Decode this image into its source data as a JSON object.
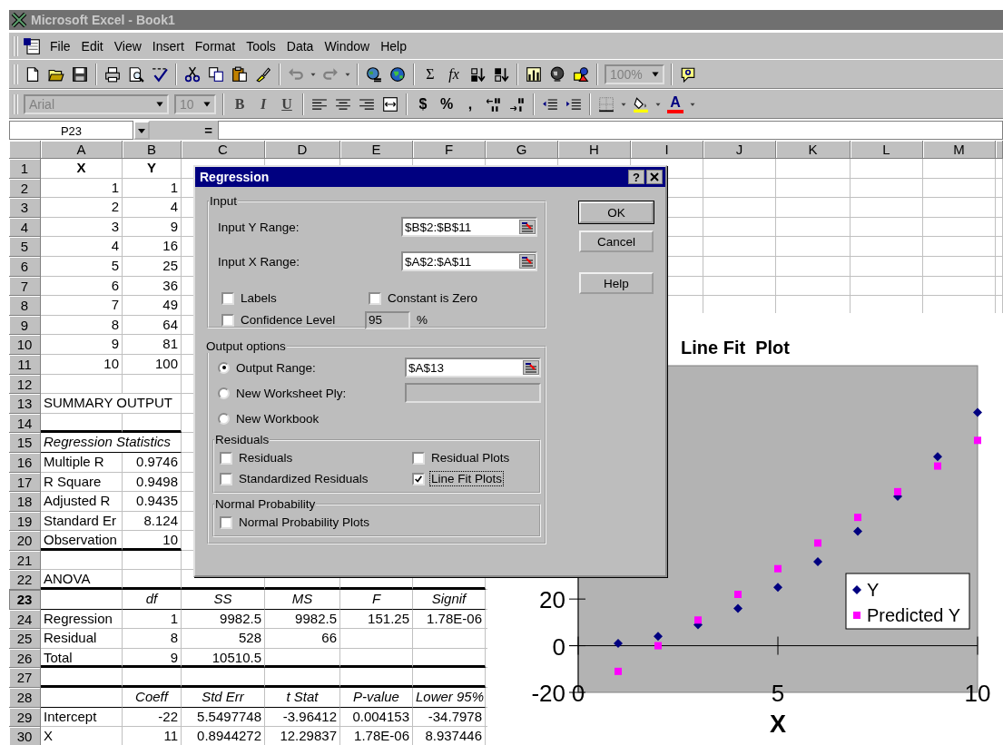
{
  "window": {
    "title": "Microsoft Excel - Book1",
    "active": false
  },
  "menu": [
    "File",
    "Edit",
    "View",
    "Insert",
    "Format",
    "Tools",
    "Data",
    "Window",
    "Help"
  ],
  "standard_toolbar": [
    {
      "kind": "new"
    },
    {
      "kind": "open"
    },
    {
      "kind": "save"
    },
    {
      "kind": "sep"
    },
    {
      "kind": "print"
    },
    {
      "kind": "preview"
    },
    {
      "kind": "spelling"
    },
    {
      "kind": "sep"
    },
    {
      "kind": "cut"
    },
    {
      "kind": "copy"
    },
    {
      "kind": "paste"
    },
    {
      "kind": "brush"
    },
    {
      "kind": "sep"
    },
    {
      "kind": "undo"
    },
    {
      "kind": "dropdown"
    },
    {
      "kind": "redo"
    },
    {
      "kind": "dropdown"
    },
    {
      "kind": "sep"
    },
    {
      "kind": "hyperlink"
    },
    {
      "kind": "web"
    },
    {
      "kind": "sep"
    },
    {
      "kind": "sum",
      "text": "Σ"
    },
    {
      "kind": "function",
      "text": "fx"
    },
    {
      "kind": "sort-asc"
    },
    {
      "kind": "sort-desc"
    },
    {
      "kind": "sep"
    },
    {
      "kind": "chart"
    },
    {
      "kind": "map"
    },
    {
      "kind": "drawing"
    },
    {
      "kind": "sep"
    },
    {
      "kind": "zoom",
      "text": "100%",
      "disabled": true
    },
    {
      "kind": "sep"
    },
    {
      "kind": "help"
    }
  ],
  "formatting_toolbar": [
    {
      "kind": "font",
      "text": "Arial",
      "disabled": true
    },
    {
      "kind": "size",
      "text": "10",
      "disabled": true
    },
    {
      "kind": "sep"
    },
    {
      "kind": "bold",
      "text": "B"
    },
    {
      "kind": "italic",
      "text": "I"
    },
    {
      "kind": "underline",
      "text": "U"
    },
    {
      "kind": "sep"
    },
    {
      "kind": "align-left"
    },
    {
      "kind": "align-center"
    },
    {
      "kind": "align-right"
    },
    {
      "kind": "merge"
    },
    {
      "kind": "sep"
    },
    {
      "kind": "currency",
      "text": "$"
    },
    {
      "kind": "percent",
      "text": "%"
    },
    {
      "kind": "comma",
      "text": ","
    },
    {
      "kind": "inc-decimal"
    },
    {
      "kind": "dec-decimal"
    },
    {
      "kind": "sep"
    },
    {
      "kind": "outdent"
    },
    {
      "kind": "indent"
    },
    {
      "kind": "sep"
    },
    {
      "kind": "borders"
    },
    {
      "kind": "dropdown"
    },
    {
      "kind": "fill-color",
      "color": "#ffff00"
    },
    {
      "kind": "dropdown"
    },
    {
      "kind": "font-color",
      "text": "A",
      "color": "#ff0000"
    },
    {
      "kind": "dropdown"
    }
  ],
  "formula_bar": {
    "name_box": "P23",
    "equals": "="
  },
  "columns": [
    "A",
    "B",
    "C",
    "D",
    "E",
    "F",
    "G",
    "H",
    "I",
    "J",
    "K",
    "L",
    "M"
  ],
  "rows": [
    {
      "number": "1",
      "selected": false,
      "kind": "header",
      "cells": {
        "a": "X",
        "b": "Y"
      },
      "rule_below": false
    },
    {
      "number": "2",
      "selected": false,
      "kind": "numbers",
      "cells": {
        "a": "1",
        "b": "1"
      },
      "rule_below": false
    },
    {
      "number": "3",
      "selected": false,
      "kind": "numbers",
      "cells": {
        "a": "2",
        "b": "4"
      },
      "rule_below": false
    },
    {
      "number": "4",
      "selected": false,
      "kind": "numbers",
      "cells": {
        "a": "3",
        "b": "9"
      },
      "rule_below": false
    },
    {
      "number": "5",
      "selected": false,
      "kind": "numbers",
      "cells": {
        "a": "4",
        "b": "16"
      },
      "rule_below": false
    },
    {
      "number": "6",
      "selected": false,
      "kind": "numbers",
      "cells": {
        "a": "5",
        "b": "25"
      },
      "rule_below": false
    },
    {
      "number": "7",
      "selected": false,
      "kind": "numbers",
      "cells": {
        "a": "6",
        "b": "36"
      },
      "rule_below": false
    },
    {
      "number": "8",
      "selected": false,
      "kind": "numbers",
      "cells": {
        "a": "7",
        "b": "49"
      },
      "rule_below": false
    },
    {
      "number": "9",
      "selected": false,
      "kind": "numbers",
      "cells": {
        "a": "8",
        "b": "64"
      },
      "rule_below": false
    },
    {
      "number": "10",
      "selected": false,
      "kind": "numbers",
      "cells": {
        "a": "9",
        "b": "81"
      },
      "rule_below": false
    },
    {
      "number": "11",
      "selected": false,
      "kind": "numbers",
      "cells": {
        "a": "10",
        "b": "100"
      },
      "rule_below": false
    },
    {
      "number": "12",
      "selected": false,
      "kind": "data",
      "rule_below": false
    },
    {
      "number": "13",
      "selected": false,
      "kind": "title",
      "cells": {
        "a": "SUMMARY OUTPUT"
      },
      "rule_below": false
    },
    {
      "number": "14",
      "selected": false,
      "kind": "data",
      "rule_below": true,
      "rule_heavy": true
    },
    {
      "number": "15",
      "selected": false,
      "kind": "italic-title",
      "cells": {
        "a": "Regression Statistics"
      },
      "rule_below": true,
      "rule_heavy": false
    },
    {
      "number": "16",
      "selected": false,
      "kind": "data",
      "cells": {
        "a": "Multiple R",
        "b": "0.9746"
      },
      "rule_below": false
    },
    {
      "number": "17",
      "selected": false,
      "kind": "data",
      "cells": {
        "a": "R Square",
        "b": "0.9498"
      },
      "rule_below": false
    },
    {
      "number": "18",
      "selected": false,
      "kind": "data",
      "cells": {
        "a": "Adjusted R",
        "b": "0.9435"
      },
      "rule_below": false
    },
    {
      "number": "19",
      "selected": false,
      "kind": "data",
      "cells": {
        "a": "Standard Er",
        "b": "8.124"
      },
      "rule_below": false
    },
    {
      "number": "20",
      "selected": false,
      "kind": "data",
      "cells": {
        "a": "Observation",
        "b": "10"
      },
      "rule_below": true,
      "rule_heavy": true
    },
    {
      "number": "21",
      "selected": false,
      "kind": "data",
      "rule_below": false
    },
    {
      "number": "22",
      "selected": false,
      "kind": "data",
      "cells": {
        "a": "ANOVA"
      },
      "rule_below": true,
      "rule_heavy": true
    },
    {
      "number": "23",
      "selected": true,
      "kind": "italic-heading",
      "cells": {
        "b": "df",
        "c": "SS",
        "d": "MS",
        "e": "F",
        "f": "Signif"
      },
      "rule_below": true,
      "rule_heavy": false
    },
    {
      "number": "24",
      "selected": false,
      "kind": "data",
      "cells": {
        "a": "Regression",
        "b": "1",
        "c": "9982.5",
        "d": "9982.5",
        "e": "151.25",
        "f": "1.78E-06"
      },
      "rule_below": false
    },
    {
      "number": "25",
      "selected": false,
      "kind": "data",
      "cells": {
        "a": "Residual",
        "b": "8",
        "c": "528",
        "d": "66"
      },
      "rule_below": false
    },
    {
      "number": "26",
      "selected": false,
      "kind": "data",
      "cells": {
        "a": "Total",
        "b": "9",
        "c": "10510.5"
      },
      "rule_below": true,
      "rule_heavy": true
    },
    {
      "number": "27",
      "selected": false,
      "kind": "data",
      "rule_below": true,
      "rule_heavy": true
    },
    {
      "number": "28",
      "selected": false,
      "kind": "italic-heading",
      "cells": {
        "b": "Coeff",
        "c": "Std Err",
        "d": "t Stat",
        "e": "P-value",
        "f": "Lower 95%"
      },
      "rule_below": true,
      "rule_heavy": false
    },
    {
      "number": "29",
      "selected": false,
      "kind": "data",
      "cells": {
        "a": "Intercept",
        "b": "-22",
        "c": "5.5497748",
        "d": "-3.96412",
        "e": "0.004153",
        "f": "-34.7978"
      },
      "rule_below": false
    },
    {
      "number": "30",
      "selected": false,
      "kind": "data",
      "cells": {
        "a": "X",
        "b": "11",
        "c": "0.8944272",
        "d": "12.29837",
        "e": "1.78E-06",
        "f": "8.937446"
      },
      "rule_below": false
    }
  ],
  "dialog": {
    "title": "Regression",
    "help": "?",
    "input": {
      "legend": "Input",
      "ranges": [
        {
          "label": "Input Y Range:",
          "value": "$B$2:$B$11"
        },
        {
          "label": "Input X Range:",
          "value": "$A$2:$A$11"
        }
      ],
      "checkboxes": [
        {
          "label": "Labels",
          "checked": false
        },
        {
          "label": "Constant is Zero",
          "checked": false
        },
        {
          "label": "Confidence Level",
          "checked": false
        }
      ],
      "confidence": {
        "value": "95",
        "unit": "%",
        "disabled": true
      }
    },
    "output": {
      "legend": "Output options",
      "radios": [
        {
          "label": "Output Range:",
          "selected": true,
          "kind": "range",
          "value": "$A$13"
        },
        {
          "label": "New Worksheet Ply:",
          "selected": false,
          "kind": "text"
        },
        {
          "label": "New Workbook",
          "selected": false,
          "kind": "plain"
        }
      ]
    },
    "residuals": {
      "legend": "Residuals",
      "checkboxes": [
        {
          "label": "Residuals",
          "checked": false,
          "focused": false
        },
        {
          "label": "Residual Plots",
          "checked": false,
          "focused": false
        },
        {
          "label": "Standardized Residuals",
          "checked": false,
          "focused": false
        },
        {
          "label": "Line Fit Plots",
          "checked": true,
          "focused": true
        }
      ]
    },
    "normal": {
      "legend": "Normal Probability",
      "checkboxes": [
        {
          "label": "Normal Probability Plots",
          "checked": false
        }
      ]
    },
    "buttons": [
      {
        "label": "OK",
        "default": true
      },
      {
        "label": "Cancel",
        "default": false
      },
      {
        "label": "Help",
        "default": false
      }
    ]
  },
  "chart": {
    "chart_data": {
      "type": "scatter",
      "title": "Line Fit  Plot",
      "xlabel": "X",
      "x": [
        1,
        2,
        3,
        4,
        5,
        6,
        7,
        8,
        9,
        10
      ],
      "series": [
        {
          "name": "Y",
          "color": "#000080",
          "values": [
            1,
            4,
            9,
            16,
            25,
            36,
            49,
            64,
            81,
            100
          ]
        },
        {
          "name": "Predicted Y",
          "color": "#ff00ff",
          "values": [
            -11,
            0,
            11,
            22,
            33,
            44,
            55,
            66,
            77,
            88
          ]
        }
      ],
      "xlim": [
        0,
        10
      ],
      "ylim": [
        -20,
        120
      ],
      "xticks": [
        0,
        5,
        10
      ],
      "yticks": [
        -20,
        0,
        20
      ],
      "legend": "right"
    }
  }
}
